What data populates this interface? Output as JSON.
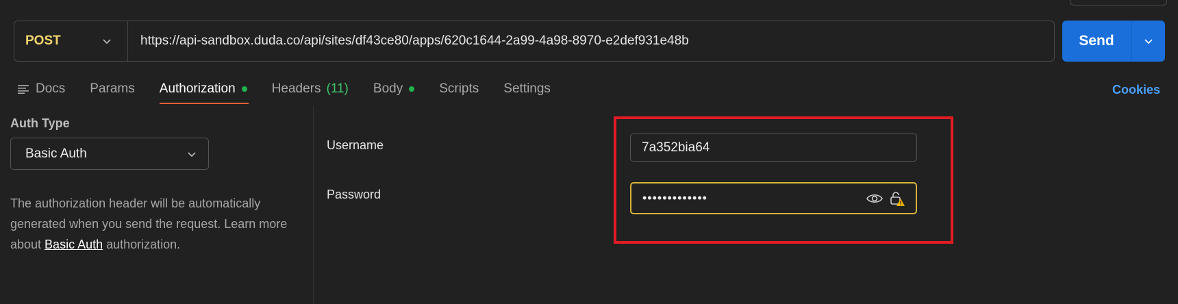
{
  "request": {
    "method": "POST",
    "url": "https://api-sandbox.duda.co/api/sites/df43ce80/apps/620c1644-2a99-4a98-8970-e2def931e48b",
    "send_label": "Send"
  },
  "tabs": [
    {
      "label": "Docs"
    },
    {
      "label": "Params"
    },
    {
      "label": "Authorization",
      "active": true,
      "dot": true
    },
    {
      "label": "Headers",
      "count": "(11)"
    },
    {
      "label": "Body",
      "dot": true
    },
    {
      "label": "Scripts"
    },
    {
      "label": "Settings"
    }
  ],
  "cookies_label": "Cookies",
  "auth": {
    "type_label": "Auth Type",
    "type_value": "Basic Auth",
    "desc_before": "The authorization header will be automatically generated when you send the request. Learn more about ",
    "desc_link": "Basic Auth",
    "desc_after": " authorization."
  },
  "form": {
    "username_label": "Username",
    "username_value": "7a352bia64",
    "password_label": "Password",
    "password_masked": "•••••••••••••"
  },
  "colors": {
    "accent_blue": "#1a6fdb",
    "method_yellow": "#f3d56c",
    "active_tab_underline": "#e0603a",
    "status_green": "#22b24c",
    "highlight_red": "#e31b23",
    "warning_yellow": "#d8b53a"
  },
  "icons": [
    "docs-icon",
    "chevron-down-icon",
    "eye-icon",
    "lock-warning-icon"
  ]
}
